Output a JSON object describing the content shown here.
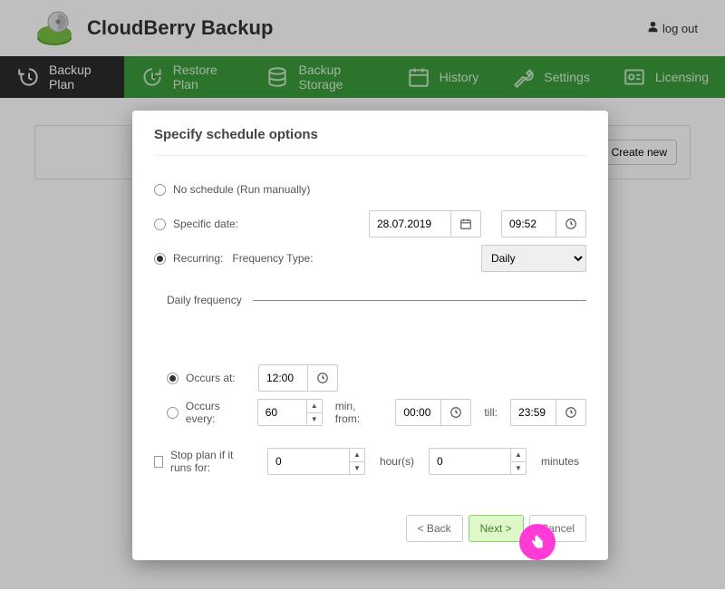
{
  "header": {
    "app_title": "CloudBerry Backup",
    "logout_label": "log out"
  },
  "nav": [
    {
      "label": "Backup Plan"
    },
    {
      "label": "Restore Plan"
    },
    {
      "label": "Backup Storage"
    },
    {
      "label": "History"
    },
    {
      "label": "Settings"
    },
    {
      "label": "Licensing"
    }
  ],
  "panel": {
    "create_label": "Create new"
  },
  "modal": {
    "title": "Specify schedule options",
    "option_no_schedule": "No schedule (Run manually)",
    "option_specific_date": "Specific date:",
    "option_recurring": "Recurring:",
    "freq_type_label": "Frequency Type:",
    "freq_type_value": "Daily",
    "specific_date_value": "28.07.2019",
    "specific_time_value": "09:52",
    "daily_frequency_label": "Daily frequency",
    "occurs_at_label": "Occurs at:",
    "occurs_at_value": "12:00",
    "occurs_every_label": "Occurs every:",
    "occurs_every_value": "60",
    "occurs_every_unit": "min, from:",
    "from_value": "00:00",
    "till_label": "till:",
    "till_value": "23:59",
    "stop_plan_label": "Stop plan if it runs for:",
    "hours_value": "0",
    "hours_unit": "hour(s)",
    "minutes_value": "0",
    "minutes_unit": "minutes",
    "back_label": "< Back",
    "next_label": "Next >",
    "cancel_label": "Cancel"
  }
}
